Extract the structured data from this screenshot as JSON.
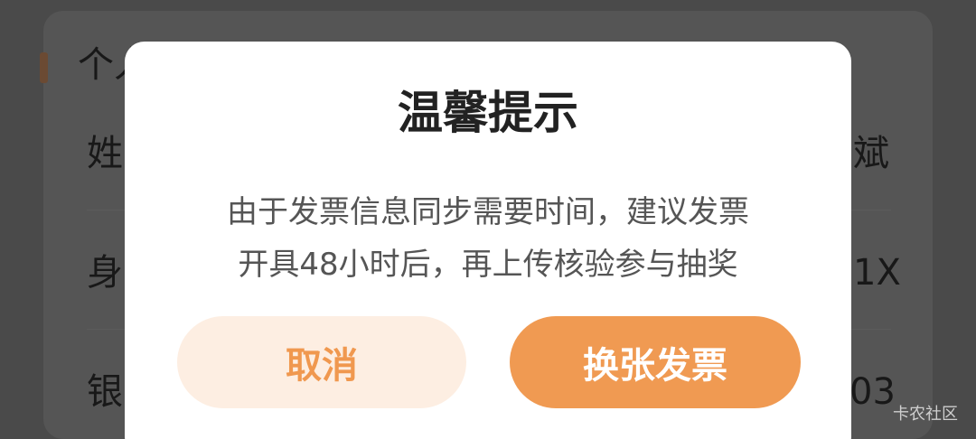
{
  "background": {
    "section_title": "个人",
    "rows": [
      {
        "label": "姓",
        "value": "斌"
      },
      {
        "label": "身",
        "value": "1X"
      },
      {
        "label": "银",
        "value": "03"
      }
    ]
  },
  "dialog": {
    "title": "温馨提示",
    "message_line1": "由于发票信息同步需要时间，建议发票",
    "message_line2": "开具48小时后，再上传核验参与抽奖",
    "cancel_label": "取消",
    "confirm_label": "换张发票"
  },
  "watermark": "卡农社区",
  "colors": {
    "accent": "#f09a52",
    "cancel_bg": "#fdeee2",
    "cancel_text": "#f0984f",
    "overlay": "#4d4d4d"
  }
}
